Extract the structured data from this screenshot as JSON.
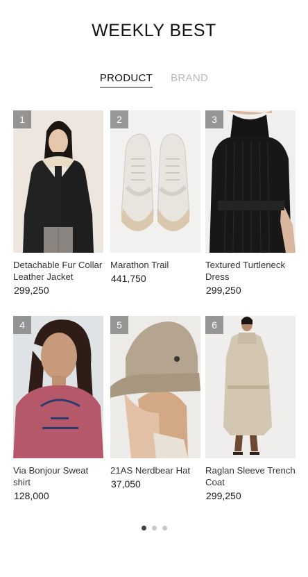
{
  "header": {
    "title": "WEEKLY BEST"
  },
  "tabs": [
    {
      "label": "PRODUCT",
      "active": true
    },
    {
      "label": "BRAND",
      "active": false
    }
  ],
  "products": [
    {
      "rank": "1",
      "name": "Detachable Fur Collar Leather Jacket",
      "price": "299,250",
      "image": "woman-black-leather-jacket"
    },
    {
      "rank": "2",
      "name": "Marathon Trail",
      "price": "441,750",
      "image": "white-sneakers"
    },
    {
      "rank": "3",
      "name": "Textured Turtleneck Dress",
      "price": "299,250",
      "image": "black-turtleneck-dress"
    },
    {
      "rank": "4",
      "name": "Via Bonjour Sweat shirt",
      "price": "128,000",
      "image": "woman-pink-sweatshirt"
    },
    {
      "rank": "5",
      "name": "21AS Nerdbear Hat",
      "price": "37,050",
      "image": "beige-bucket-hat"
    },
    {
      "rank": "6",
      "name": "Raglan Sleeve Trench Coat",
      "price": "299,250",
      "image": "beige-trench-coat"
    }
  ],
  "pagination": {
    "total": 3,
    "current": 1
  },
  "colors": {
    "text": "#1a1a1a",
    "tab_inactive": "#b9b9b9",
    "rank_badge": "#787878",
    "dot_active": "#444444",
    "dot_inactive": "#c8c8c8"
  }
}
